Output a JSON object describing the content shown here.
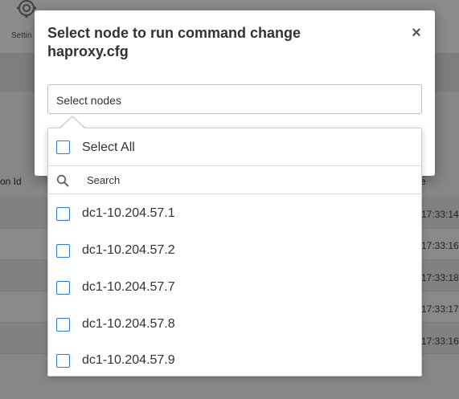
{
  "background": {
    "settings_label": "Settin",
    "col_left_header": "on Id",
    "col_right_header": "e",
    "row_times": [
      "17:33:14",
      "17:33:16",
      "17:33:18",
      "17:33:17",
      "17:33:16"
    ]
  },
  "modal": {
    "title": "Select node to run command change haproxy.cfg",
    "close_label": "×",
    "select_placeholder": "Select nodes"
  },
  "dropdown": {
    "select_all_label": "Select All",
    "search_placeholder": "Search",
    "options": [
      {
        "label": "dc1-10.204.57.1",
        "checked": false
      },
      {
        "label": "dc1-10.204.57.2",
        "checked": false
      },
      {
        "label": "dc1-10.204.57.7",
        "checked": false
      },
      {
        "label": "dc1-10.204.57.8",
        "checked": false
      },
      {
        "label": "dc1-10.204.57.9",
        "checked": false
      }
    ]
  },
  "colors": {
    "checkbox_border": "#2f7bd6",
    "overlay": "rgba(0,0,0,0.45)"
  }
}
